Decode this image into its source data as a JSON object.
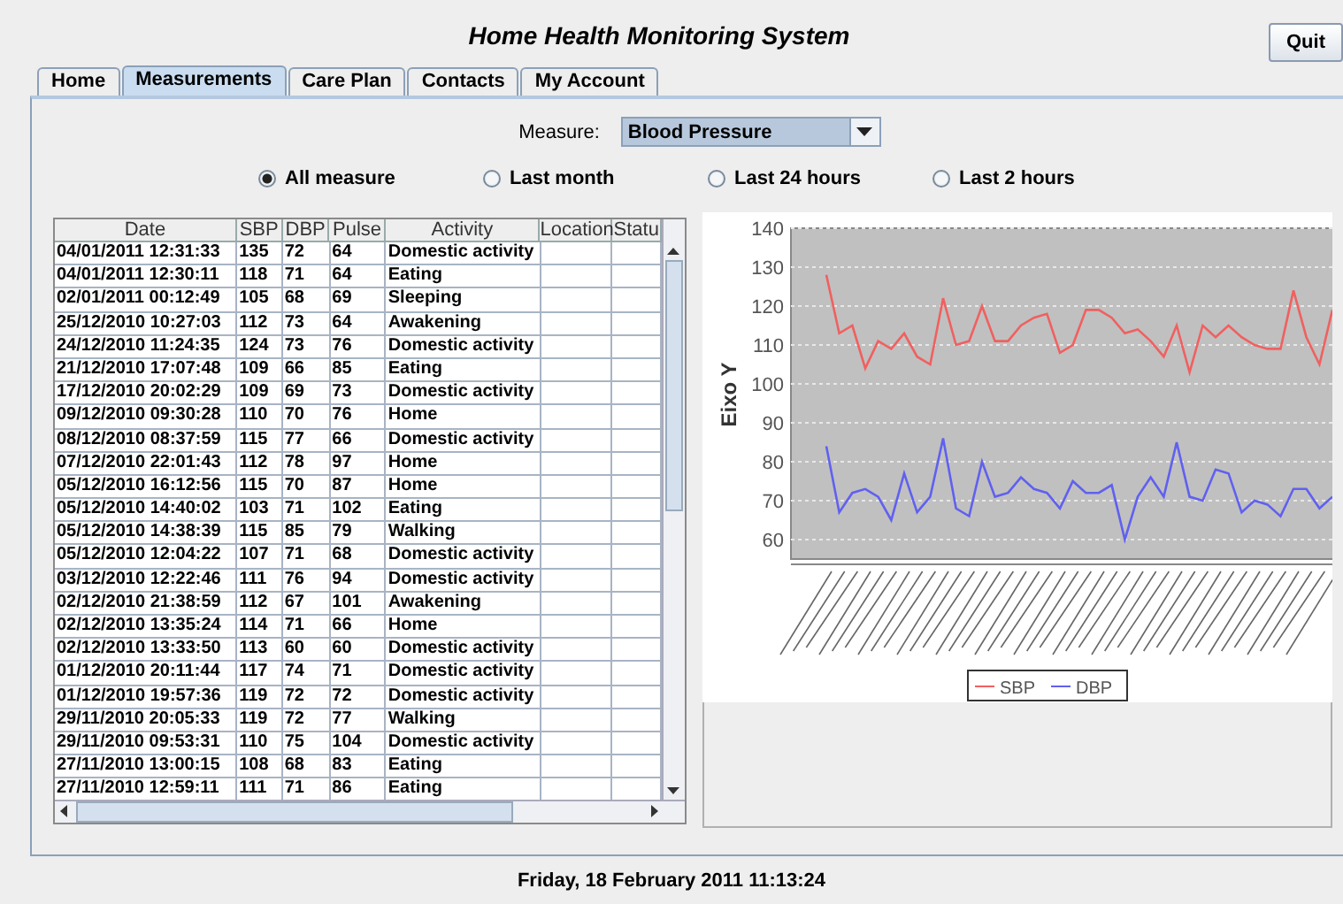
{
  "window": {
    "title": "Home Health Monitoring System"
  },
  "quit_button": "Quit",
  "tabs": [
    {
      "label": "Home",
      "selected": false
    },
    {
      "label": "Measurements",
      "selected": true
    },
    {
      "label": "Care Plan",
      "selected": false
    },
    {
      "label": "Contacts",
      "selected": false
    },
    {
      "label": "My Account",
      "selected": false
    }
  ],
  "measure": {
    "label": "Measure:",
    "value": "Blood Pressure"
  },
  "periods": [
    {
      "label": "All measure",
      "selected": true
    },
    {
      "label": "Last month",
      "selected": false
    },
    {
      "label": "Last 24 hours",
      "selected": false
    },
    {
      "label": "Last 2 hours",
      "selected": false
    }
  ],
  "table": {
    "columns": [
      "Date",
      "SBP",
      "DBP",
      "Pulse",
      "Activity",
      "Location",
      "Statu"
    ],
    "rows": [
      [
        "04/01/2011 12:31:33",
        "135",
        "72",
        "64",
        "Domestic activity"
      ],
      [
        "04/01/2011 12:30:11",
        "118",
        "71",
        "64",
        "Eating"
      ],
      [
        "02/01/2011 00:12:49",
        "105",
        "68",
        "69",
        "Sleeping"
      ],
      [
        "25/12/2010 10:27:03",
        "112",
        "73",
        "64",
        "Awakening"
      ],
      [
        "24/12/2010 11:24:35",
        "124",
        "73",
        "76",
        "Domestic activity"
      ],
      [
        "21/12/2010 17:07:48",
        "109",
        "66",
        "85",
        "Eating"
      ],
      [
        "17/12/2010 20:02:29",
        "109",
        "69",
        "73",
        "Domestic activity"
      ],
      [
        "09/12/2010 09:30:28",
        "110",
        "70",
        "76",
        "Home"
      ],
      [
        "08/12/2010 08:37:59",
        "115",
        "77",
        "66",
        "Domestic activity"
      ],
      [
        "07/12/2010 22:01:43",
        "112",
        "78",
        "97",
        "Home"
      ],
      [
        "05/12/2010 16:12:56",
        "115",
        "70",
        "87",
        "Home"
      ],
      [
        "05/12/2010 14:40:02",
        "103",
        "71",
        "102",
        "Eating"
      ],
      [
        "05/12/2010 14:38:39",
        "115",
        "85",
        "79",
        "Walking"
      ],
      [
        "05/12/2010 12:04:22",
        "107",
        "71",
        "68",
        "Domestic activity"
      ],
      [
        "03/12/2010 12:22:46",
        "111",
        "76",
        "94",
        "Domestic activity"
      ],
      [
        "02/12/2010 21:38:59",
        "112",
        "67",
        "101",
        "Awakening"
      ],
      [
        "02/12/2010 13:35:24",
        "114",
        "71",
        "66",
        "Home"
      ],
      [
        "02/12/2010 13:33:50",
        "113",
        "60",
        "60",
        "Domestic activity"
      ],
      [
        "01/12/2010 20:11:44",
        "117",
        "74",
        "71",
        "Domestic activity"
      ],
      [
        "01/12/2010 19:57:36",
        "119",
        "72",
        "72",
        "Domestic activity"
      ],
      [
        "29/11/2010 20:05:33",
        "119",
        "72",
        "77",
        "Walking"
      ],
      [
        "29/11/2010 09:53:31",
        "110",
        "75",
        "104",
        "Domestic activity"
      ],
      [
        "27/11/2010 13:00:15",
        "108",
        "68",
        "83",
        "Eating"
      ],
      [
        "27/11/2010 12:59:11",
        "111",
        "71",
        "86",
        "Eating"
      ]
    ]
  },
  "chart": {
    "chart_data": {
      "type": "line",
      "grid": true,
      "legend": true,
      "ylabel": "Eixo Y",
      "ylim": [
        55,
        140
      ],
      "yticks": [
        60,
        70,
        80,
        90,
        100,
        110,
        120,
        130,
        140
      ],
      "series": [
        {
          "name": "SBP",
          "color": "#f06060",
          "values": [
            128,
            113,
            115,
            104,
            111,
            109,
            113,
            107,
            105,
            122,
            110,
            111,
            120,
            111,
            111,
            115,
            117,
            118,
            108,
            110,
            119,
            119,
            117,
            113,
            114,
            111,
            107,
            115,
            103,
            115,
            112,
            115,
            112,
            110,
            109,
            109,
            124,
            112,
            105,
            119
          ]
        },
        {
          "name": "DBP",
          "color": "#6060f0",
          "values": [
            84,
            67,
            72,
            73,
            71,
            65,
            77,
            67,
            71,
            86,
            68,
            66,
            80,
            71,
            72,
            76,
            73,
            72,
            68,
            75,
            72,
            72,
            74,
            60,
            71,
            76,
            71,
            85,
            71,
            70,
            78,
            77,
            67,
            70,
            69,
            66,
            73,
            73,
            68,
            71
          ]
        }
      ]
    }
  },
  "status_bar": "Friday, 18 February 2011 11:13:24"
}
